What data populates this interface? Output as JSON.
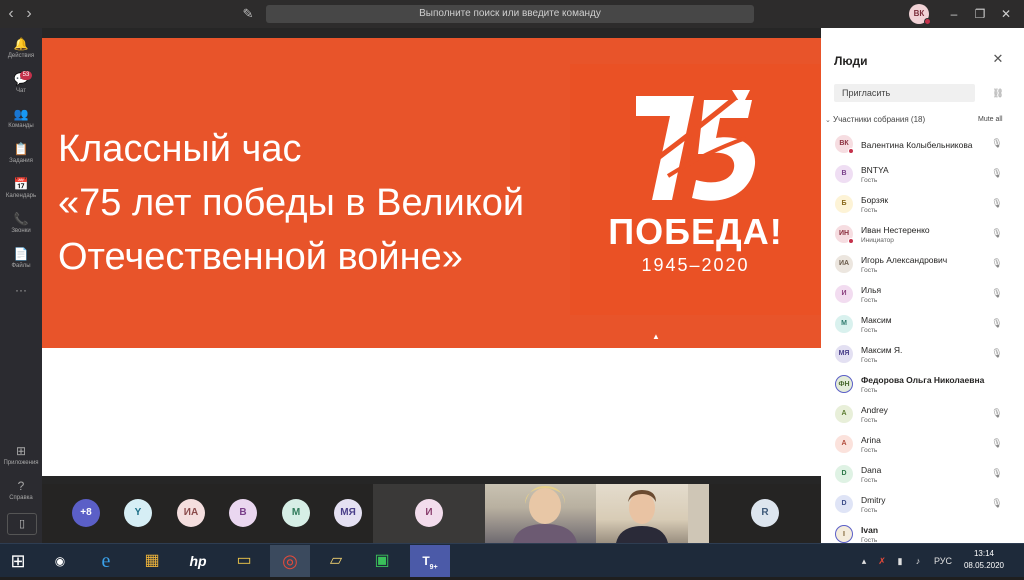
{
  "titlebar": {
    "search_placeholder": "Выполните поиск или введите команду",
    "user_initials": "ВК"
  },
  "rail": {
    "items": [
      {
        "label": "Действия",
        "icon": "bell-icon",
        "glyph": "🔔"
      },
      {
        "label": "Чат",
        "icon": "chat-icon",
        "glyph": "💬",
        "badge": "53"
      },
      {
        "label": "Команды",
        "icon": "teams-icon",
        "glyph": "👥"
      },
      {
        "label": "Задания",
        "icon": "assignments-icon",
        "glyph": "📋"
      },
      {
        "label": "Календарь",
        "icon": "calendar-icon",
        "glyph": "📅"
      },
      {
        "label": "Звонки",
        "icon": "phone-icon",
        "glyph": "📞"
      },
      {
        "label": "Файлы",
        "icon": "files-icon",
        "glyph": "📄"
      },
      {
        "label": "",
        "icon": "more-icon",
        "glyph": "···"
      }
    ],
    "apps_label": "Приложения",
    "help_label": "Справка"
  },
  "slide": {
    "title_line1": "Классный час",
    "title_line2": "«75 лет победы в Великой",
    "title_line3": "Отечественной войне»",
    "logo_word": "ПОБЕДА!",
    "logo_years": "1945–2020",
    "bg_color": "#e8542a"
  },
  "strip": {
    "tiles": [
      {
        "initials": "+8",
        "bg": "#5b5fc7",
        "fg": "#ffffff"
      },
      {
        "initials": "Y",
        "bg": "#d6eef5",
        "fg": "#1b6f87"
      },
      {
        "initials": "ИА",
        "bg": "#f4dede",
        "fg": "#8a4a4a"
      },
      {
        "initials": "В",
        "bg": "#ead7f0",
        "fg": "#7a3f8a"
      },
      {
        "initials": "М",
        "bg": "#d6eee6",
        "fg": "#2f7a5a"
      },
      {
        "initials": "МЯ",
        "bg": "#e4e0f2",
        "fg": "#4a3f8a"
      },
      {
        "initials": "И",
        "bg": "#f2dcec",
        "fg": "#8a3f6e"
      },
      {
        "initials": "R",
        "bg": "#dde5ee",
        "fg": "#3f5a7a"
      }
    ]
  },
  "panel": {
    "title": "Люди",
    "invite_placeholder": "Пригласить",
    "group_label": "Участники собрания (18)",
    "mute_all": "Mute all",
    "participants": [
      {
        "initials": "ВК",
        "name": "Валентина Колыбельникова",
        "role": "",
        "bg": "#f6dde1",
        "fg": "#8a2f3f",
        "dot": true,
        "bold": false
      },
      {
        "initials": "B",
        "name": "BNTYA",
        "role": "Гость",
        "bg": "#efdef3",
        "fg": "#7a3f8a",
        "dot": false,
        "bold": false
      },
      {
        "initials": "Б",
        "name": "Борзяк",
        "role": "Гость",
        "bg": "#fdf3d6",
        "fg": "#8a6a1f",
        "dot": false,
        "bold": false
      },
      {
        "initials": "ИН",
        "name": "Иван Нестеренко",
        "role": "Инициатор",
        "bg": "#f6dde1",
        "fg": "#8a2f3f",
        "dot": true,
        "bold": false
      },
      {
        "initials": "ИА",
        "name": "Игорь Александрович",
        "role": "Гость",
        "bg": "#ece6df",
        "fg": "#6a5a4a",
        "dot": false,
        "bold": false
      },
      {
        "initials": "И",
        "name": "Илья",
        "role": "Гость",
        "bg": "#f2dcf0",
        "fg": "#8a3f7e",
        "dot": false,
        "bold": false
      },
      {
        "initials": "М",
        "name": "Максим",
        "role": "Гость",
        "bg": "#d9f1ee",
        "fg": "#2f7a6e",
        "dot": false,
        "bold": false
      },
      {
        "initials": "МЯ",
        "name": "Максим Я.",
        "role": "Гость",
        "bg": "#e3e0f2",
        "fg": "#4a3f8a",
        "dot": false,
        "bold": false
      },
      {
        "initials": "ФН",
        "name": "Федорова Ольга Николаевна",
        "role": "Гость",
        "bg": "#e4ecd9",
        "fg": "#4a6a2f",
        "dot": false,
        "bold": true
      },
      {
        "initials": "A",
        "name": "Andrey",
        "role": "Гость",
        "bg": "#e8efd9",
        "fg": "#5a7a2f",
        "dot": false,
        "bold": false
      },
      {
        "initials": "A",
        "name": "Arina",
        "role": "Гость",
        "bg": "#fbe2dc",
        "fg": "#b04a3a",
        "dot": false,
        "bold": false
      },
      {
        "initials": "D",
        "name": "Dana",
        "role": "Гость",
        "bg": "#dff2e4",
        "fg": "#2f7a4a",
        "dot": false,
        "bold": false
      },
      {
        "initials": "D",
        "name": "Dmitry",
        "role": "Гость",
        "bg": "#dfe4f6",
        "fg": "#3f4f8a",
        "dot": false,
        "bold": false
      },
      {
        "initials": "I",
        "name": "Ivan",
        "role": "Гость",
        "bg": "#f4ecdc",
        "fg": "#7a5f2f",
        "dot": false,
        "bold": true
      }
    ]
  },
  "taskbar": {
    "apps": [
      {
        "name": "app-eye",
        "glyph": "◉"
      },
      {
        "name": "internet-explorer",
        "glyph": "e"
      },
      {
        "name": "app-tiles",
        "glyph": "▦"
      },
      {
        "name": "hp-app",
        "glyph": "hp"
      },
      {
        "name": "file-explorer",
        "glyph": "▭"
      },
      {
        "name": "chrome",
        "glyph": "◎"
      },
      {
        "name": "python-app",
        "glyph": "▱"
      },
      {
        "name": "store-app",
        "glyph": "▣"
      },
      {
        "name": "teams-app",
        "glyph": "T"
      }
    ],
    "teams_badge": "9+",
    "lang": "РУС",
    "time": "13:14",
    "date": "08.05.2020"
  }
}
